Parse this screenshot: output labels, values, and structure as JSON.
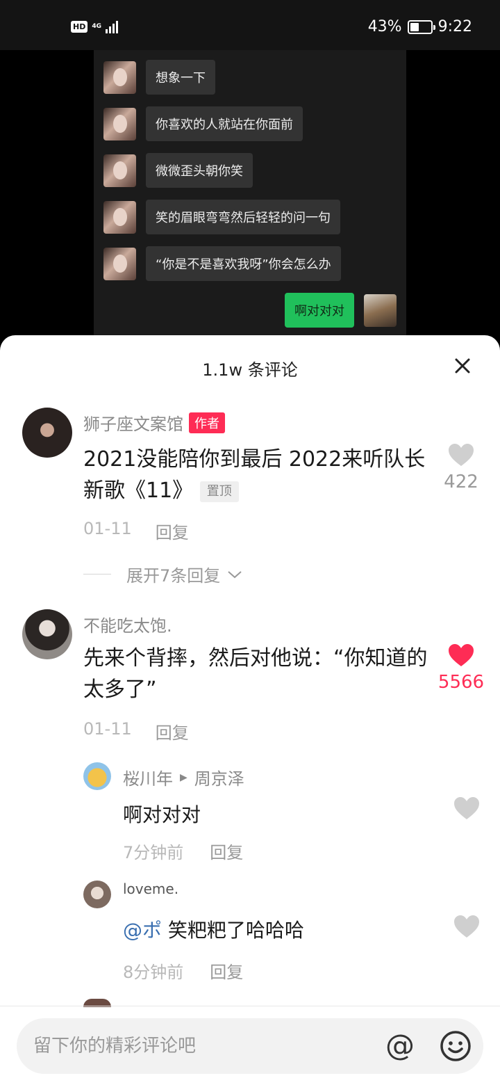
{
  "status_bar": {
    "hd": "HD",
    "network": "4G",
    "battery_percent": "43%",
    "battery_level": 0.43,
    "time": "9:22"
  },
  "chat": {
    "messages": [
      {
        "text": "想象一下"
      },
      {
        "text": "你喜欢的人就站在你面前"
      },
      {
        "text": "微微歪头朝你笑"
      },
      {
        "text": "笑的眉眼弯弯然后轻轻的问一句"
      },
      {
        "text": "“你是不是喜欢我呀”你会怎么办"
      }
    ],
    "reply": {
      "text": "啊对对对"
    }
  },
  "sheet": {
    "title": "1.1w 条评论"
  },
  "comments": [
    {
      "name": "狮子座文案馆",
      "author_tag": "作者",
      "text": "2021没能陪你到最后 2022来听队长新歌《11》",
      "pin_tag": "置顶",
      "date": "01-11",
      "reply_label": "回复",
      "likes": "422",
      "expand_label": "展开7条回复"
    },
    {
      "name": "不能吃太饱.",
      "text": "先来个背摔，然后对他说：“你知道的太多了”",
      "date": "01-11",
      "reply_label": "回复",
      "likes": "5566",
      "liked": true
    }
  ],
  "replies": [
    {
      "name": "桜川年",
      "to": "周京泽",
      "text": "啊对对对",
      "time": "7分钟前",
      "reply_label": "回复"
    },
    {
      "name": "loveme.",
      "mention": "@ポ",
      "text": "笑粑粑了哈哈哈",
      "time": "8分钟前",
      "reply_label": "回复"
    }
  ],
  "input": {
    "placeholder": "留下你的精彩评论吧",
    "at_symbol": "@"
  },
  "colors": {
    "accent_red": "#fe2c55",
    "bubble_green": "#20c05b",
    "mention_blue": "#3a6fb0"
  },
  "icons": [
    "close-icon",
    "heart-icon",
    "chevron-down-icon",
    "at-icon",
    "emoji-icon",
    "battery-icon",
    "signal-icon"
  ]
}
